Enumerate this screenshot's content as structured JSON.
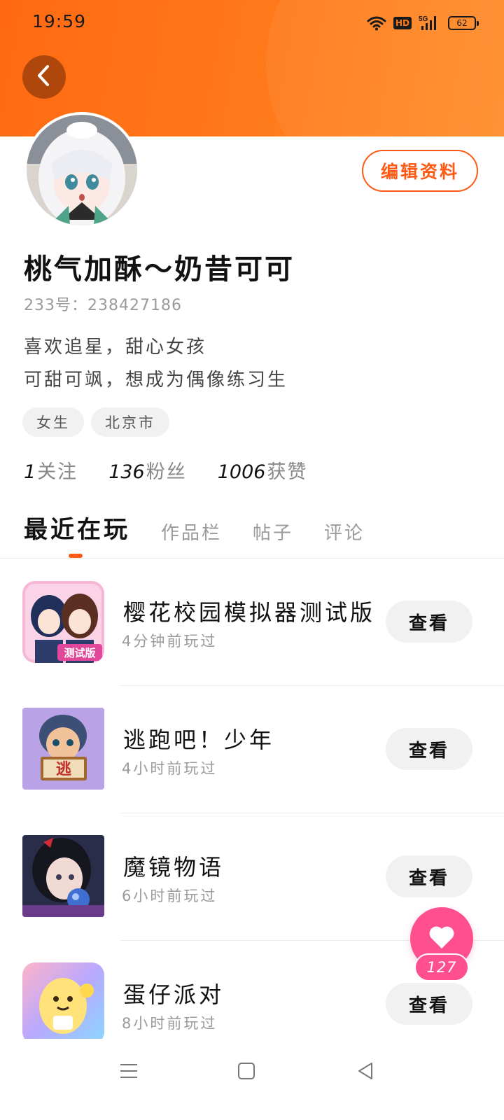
{
  "status_bar": {
    "time": "19:59",
    "network": "5G",
    "hd_label": "HD",
    "battery_level": "62",
    "icons": [
      "wifi-icon",
      "hd-icon",
      "signal-icon",
      "battery-icon"
    ]
  },
  "header": {
    "back_icon": "chevron-left-icon",
    "accent_color": "#ff6a12"
  },
  "profile": {
    "username": "桃气加酥～奶昔可可",
    "user_id": "233号：238427186",
    "bio_lines": [
      "喜欢追星，甜心女孩",
      "可甜可飒，想成为偶像练习生"
    ],
    "tags": [
      "女生",
      "北京市"
    ],
    "edit_label": "编辑资料",
    "stats": {
      "following": {
        "value": "1",
        "label": "关注"
      },
      "fans": {
        "value": "136",
        "label": "粉丝"
      },
      "likes": {
        "value": "1006",
        "label": "获赞"
      }
    }
  },
  "tabs": [
    {
      "label": "最近在玩",
      "active": true
    },
    {
      "label": "作品栏",
      "active": false
    },
    {
      "label": "帖子",
      "active": false
    },
    {
      "label": "评论",
      "active": false
    }
  ],
  "games": [
    {
      "name": "樱花校园模拟器测试版",
      "time": "4分钟前玩过",
      "action": "查看",
      "badge": "测试版"
    },
    {
      "name": "逃跑吧！少年",
      "time": "4小时前玩过",
      "action": "查看",
      "badge": "逃"
    },
    {
      "name": "魔镜物语",
      "time": "6小时前玩过",
      "action": "查看"
    },
    {
      "name": "蛋仔派对",
      "time": "8小时前玩过",
      "action": "查看"
    }
  ],
  "like_fab": {
    "count": "127",
    "icon": "heart-icon",
    "color": "#ff4f8e"
  },
  "bottom_nav": [
    "menu-icon",
    "home-icon",
    "back-triangle-icon"
  ]
}
